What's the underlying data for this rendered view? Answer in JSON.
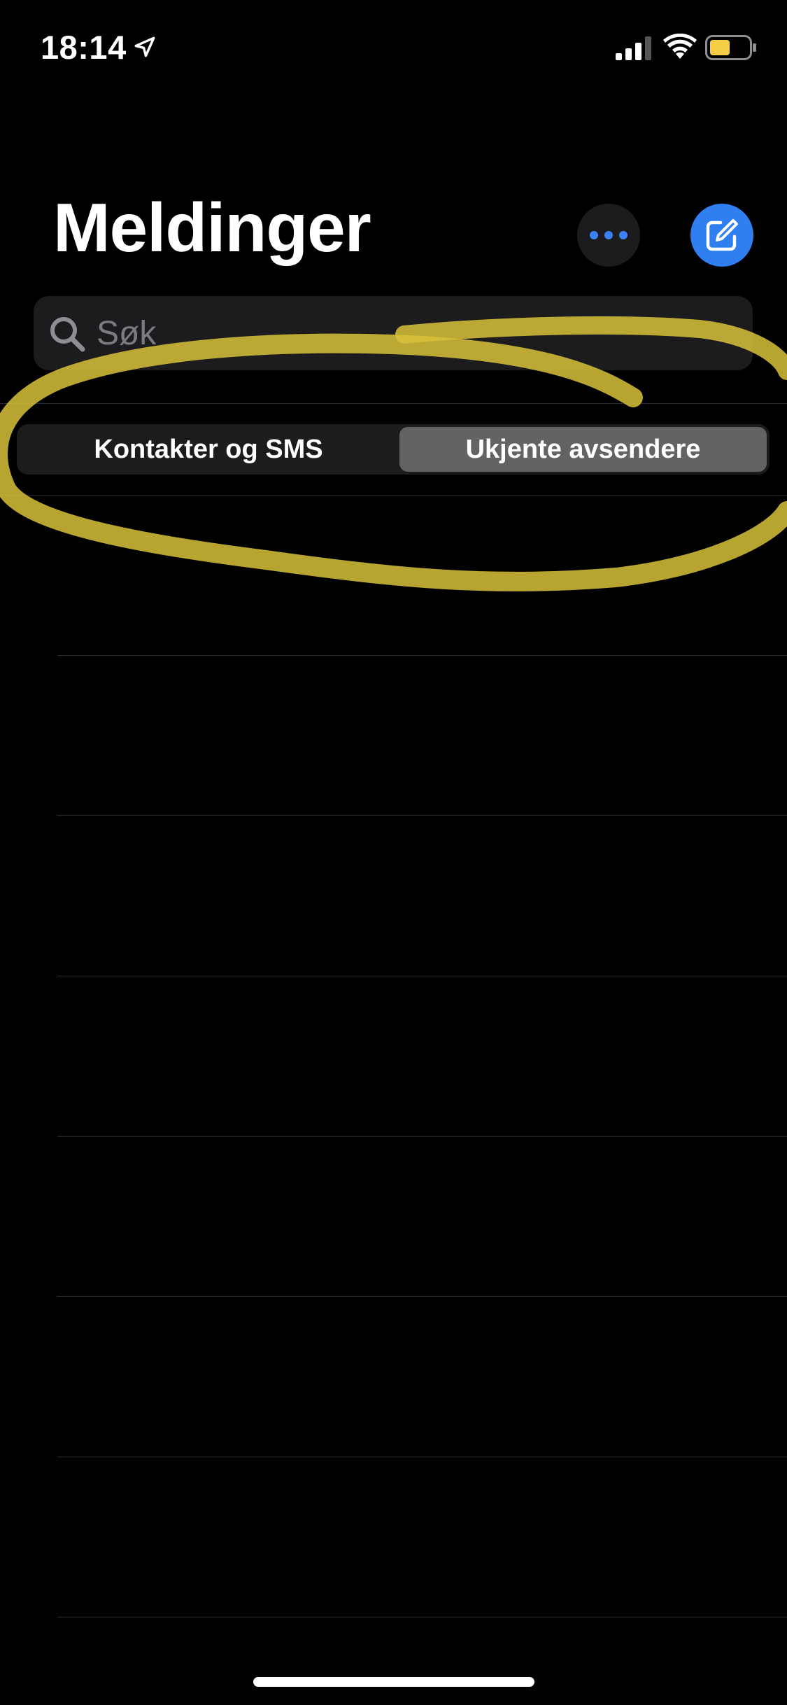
{
  "status_bar": {
    "time": "18:14",
    "location_icon": "location-arrow-icon",
    "signal_icon": "cellular-signal-icon",
    "wifi_icon": "wifi-icon",
    "battery_icon": "battery-icon",
    "battery_color": "#f5cf45"
  },
  "header": {
    "title": "Meldinger",
    "more_icon": "ellipsis-icon",
    "compose_icon": "compose-icon",
    "accent_color": "#2f7ff0"
  },
  "search": {
    "placeholder": "Søk",
    "value": ""
  },
  "filter": {
    "segments": [
      {
        "label": "Kontakter og SMS",
        "selected": false
      },
      {
        "label": "Ukjente avsendere",
        "selected": true
      }
    ]
  },
  "annotation": {
    "color": "#d8c23a",
    "shape": "hand-drawn-ellipse"
  },
  "message_list": {
    "rows": 7
  }
}
